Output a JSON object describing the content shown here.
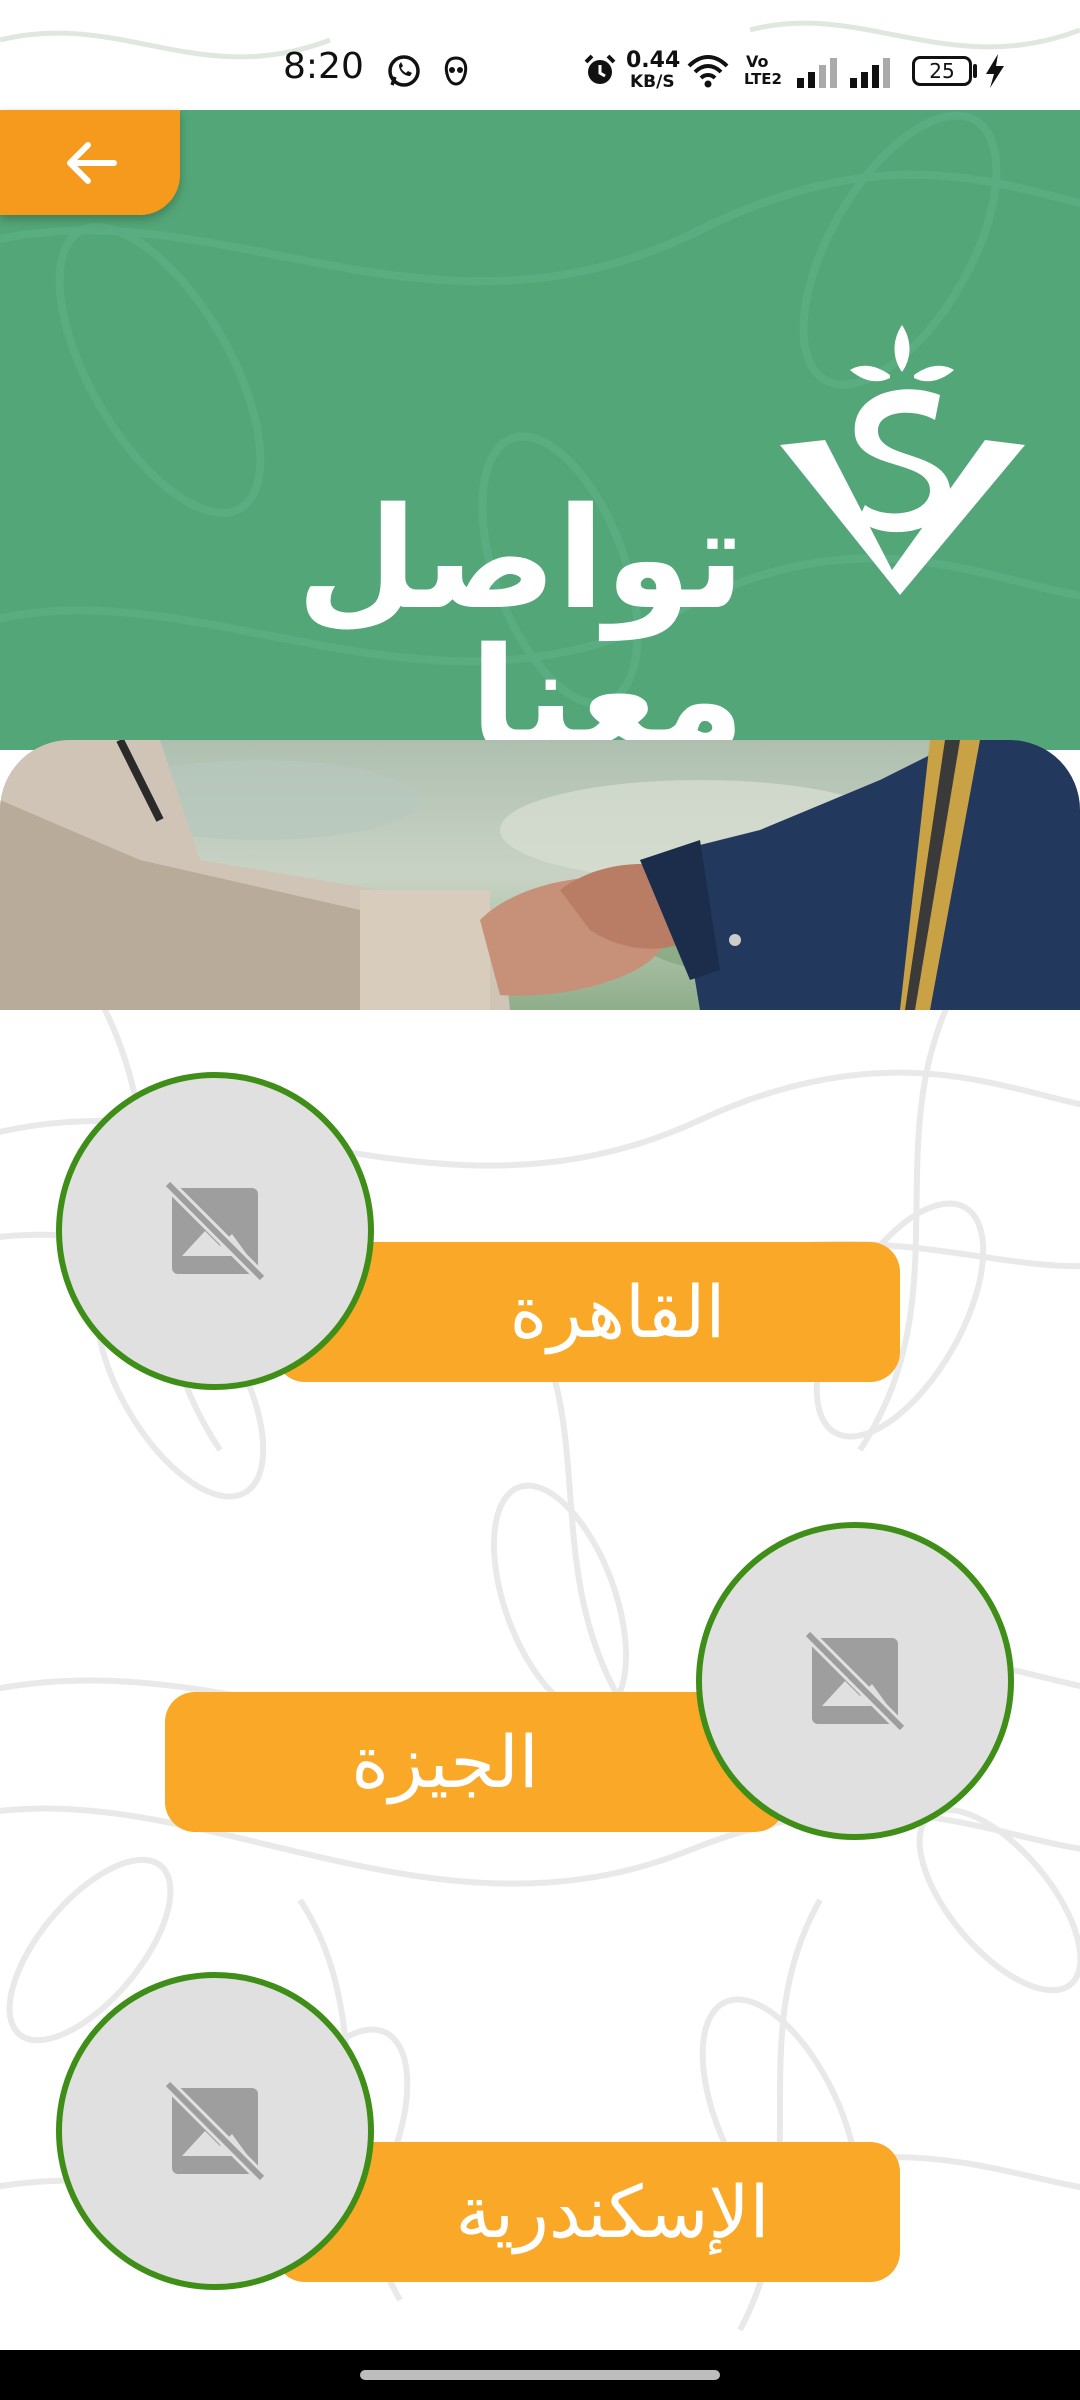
{
  "status_bar": {
    "time": "8:20",
    "net_speed_value": "0.44",
    "net_speed_unit": "KB/S",
    "volte_top": "Vo",
    "volte_bottom": "LTE2",
    "battery": "25"
  },
  "header": {
    "title": "تواصل معنا",
    "header_color": "#53a678",
    "back_color": "#f59a1d"
  },
  "cities": [
    {
      "name": "القاهرة"
    },
    {
      "name": "الجيزة"
    },
    {
      "name": "الإسكندرية"
    }
  ],
  "colors": {
    "city_button": "#f9a828",
    "circle_border": "#3e8e17",
    "placeholder_bg": "#e0e0e0"
  },
  "icons": {
    "back": "arrow-left-icon",
    "placeholder": "broken-image-icon"
  }
}
